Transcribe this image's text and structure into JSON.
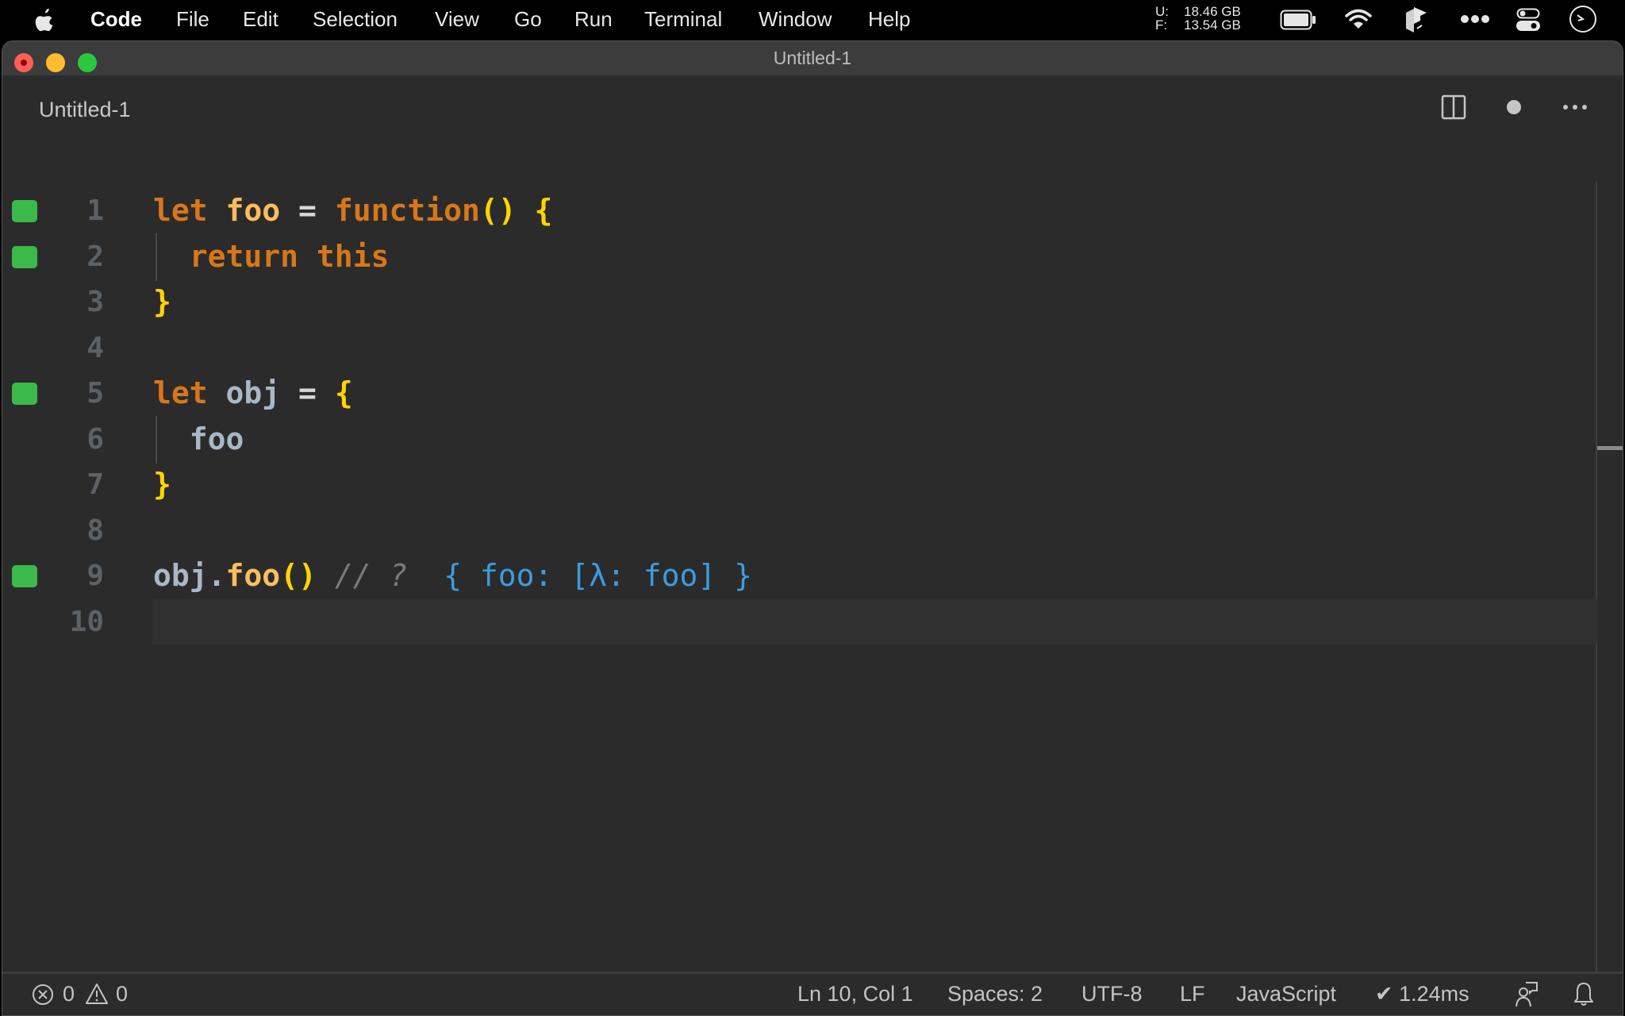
{
  "menubar": {
    "app_name": "Code",
    "items": [
      "File",
      "Edit",
      "Selection",
      "View",
      "Go",
      "Run",
      "Terminal",
      "Window",
      "Help"
    ],
    "memory": {
      "used_label": "U:",
      "used_value": "18.46 GB",
      "free_label": "F:",
      "free_value": "13.54 GB"
    },
    "tray_icons": [
      "battery-icon",
      "wifi-icon",
      "box-icon",
      "more-icon",
      "control-center-icon",
      "clock-icon"
    ]
  },
  "window": {
    "title": "Untitled-1",
    "tab": {
      "label": "Untitled-1",
      "dirty": true
    },
    "tab_actions": [
      "split-editor-icon",
      "unsaved-dot-icon",
      "more-actions-icon"
    ]
  },
  "editor": {
    "current_line": 10,
    "lines": [
      {
        "n": "1",
        "marker": true,
        "tokens": [
          [
            "k",
            "let"
          ],
          [
            "op",
            " "
          ],
          [
            "fn",
            "foo"
          ],
          [
            "op",
            " = "
          ],
          [
            "k",
            "function"
          ],
          [
            "br",
            "()"
          ],
          [
            "op",
            " "
          ],
          [
            "br",
            "{"
          ]
        ]
      },
      {
        "n": "2",
        "marker": true,
        "tokens": [
          [
            "op",
            "  "
          ],
          [
            "k",
            "return this"
          ]
        ]
      },
      {
        "n": "3",
        "marker": false,
        "tokens": [
          [
            "br",
            "}"
          ]
        ]
      },
      {
        "n": "4",
        "marker": false,
        "tokens": []
      },
      {
        "n": "5",
        "marker": true,
        "tokens": [
          [
            "k",
            "let"
          ],
          [
            "op",
            " "
          ],
          [
            "id",
            "obj"
          ],
          [
            "op",
            " = "
          ],
          [
            "br",
            "{"
          ]
        ]
      },
      {
        "n": "6",
        "marker": false,
        "tokens": [
          [
            "op",
            "  "
          ],
          [
            "id",
            "foo"
          ]
        ]
      },
      {
        "n": "7",
        "marker": false,
        "tokens": [
          [
            "br",
            "}"
          ]
        ]
      },
      {
        "n": "8",
        "marker": false,
        "tokens": []
      },
      {
        "n": "9",
        "marker": true,
        "tokens": [
          [
            "id",
            "obj."
          ],
          [
            "fn",
            "foo"
          ],
          [
            "br",
            "()"
          ],
          [
            "op",
            " "
          ],
          [
            "cm",
            "// ?"
          ],
          [
            "op",
            "  "
          ],
          [
            "res",
            "{ foo: [λ: foo] }"
          ]
        ]
      },
      {
        "n": "10",
        "marker": false,
        "tokens": []
      }
    ]
  },
  "statusbar": {
    "errors": "0",
    "warnings": "0",
    "cursor": "Ln 10, Col 1",
    "indent": "Spaces: 2",
    "encoding": "UTF-8",
    "eol": "LF",
    "language": "JavaScript",
    "timing": "✔ 1.24ms"
  },
  "colors": {
    "keyword": "#d87719",
    "function_name": "#fdbd5e",
    "bracket": "#ffd500",
    "identifier": "#a9b7c6",
    "result": "#3b9cde",
    "marker": "#3bb94a",
    "editor_bg": "#2b2b2b"
  }
}
